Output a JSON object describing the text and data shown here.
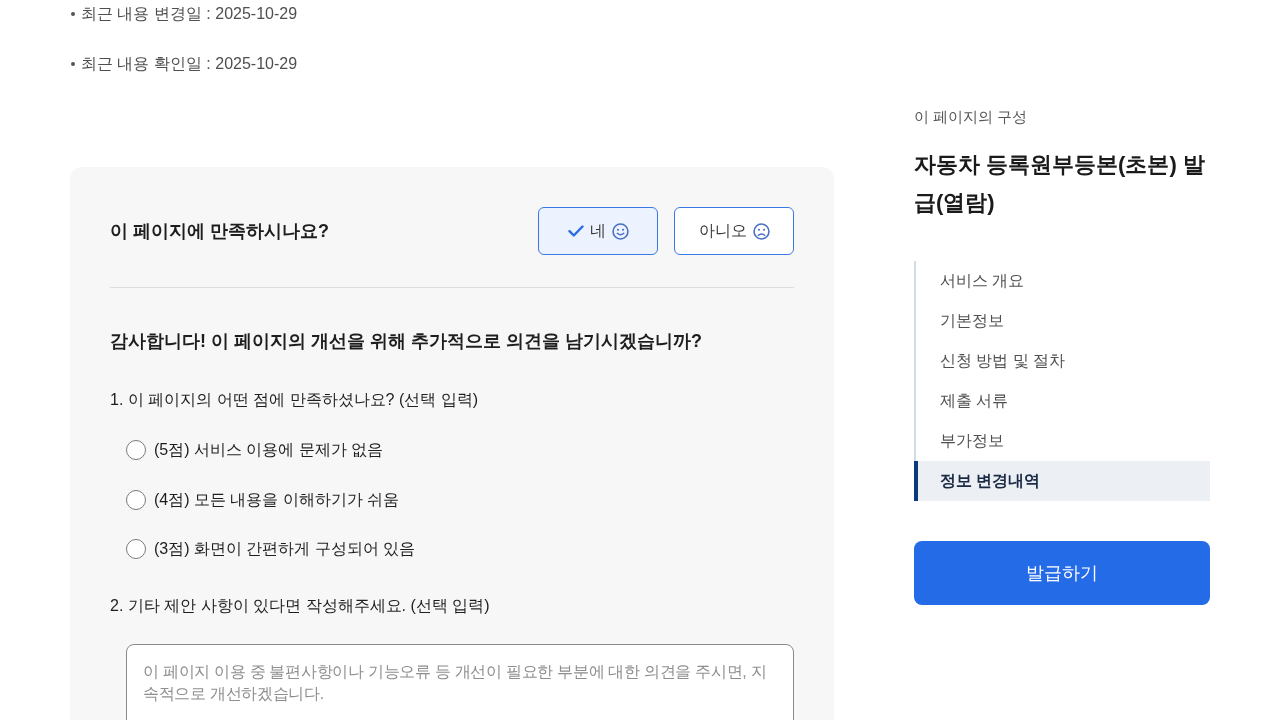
{
  "page_info": {
    "items": [
      "최근 내용 변경일 : 2025-10-29",
      "최근 내용 확인일 : 2025-10-29"
    ]
  },
  "feedback": {
    "question": "이 페이지에 만족하시나요?",
    "answers": [
      {
        "kind": "yes",
        "label": "네",
        "selected": true
      },
      {
        "kind": "no",
        "label": "아니오",
        "selected": false
      }
    ],
    "follow_up": "감사합니다! 이 페이지의 개선을 위해 추가적으로 의견을 남기시겠습니까?",
    "questions": [
      {
        "kind": "choice",
        "label": "1. 이 페이지의 어떤 점에 만족하셨나요? (선택 입력)",
        "options": [
          {
            "label": "(5점) 서비스 이용에 문제가 없음",
            "selected": false
          },
          {
            "label": "(4점) 모든 내용을 이해하기가 쉬움",
            "selected": false
          },
          {
            "label": "(3점) 화면이 간편하게 구성되어 있음",
            "selected": false
          }
        ]
      },
      {
        "kind": "text",
        "label": "2. 기타 제안 사항이 있다면 작성해주세요. (선택 입력)",
        "placeholder": "이 페이지 이용 중 불편사항이나 기능오류 등 개선이 필요한 부분에 대한 의견을 주시면, 지속적으로 개선하겠습니다."
      }
    ]
  },
  "sidebar": {
    "caption": "이 페이지의 구성",
    "title": "자동차 등록원부등본(초본) 발급(열람)",
    "nav": [
      {
        "label": "서비스 개요",
        "selected": false
      },
      {
        "label": "기본정보",
        "selected": false
      },
      {
        "label": "신청 방법 및 절차",
        "selected": false
      },
      {
        "label": "제출 서류",
        "selected": false
      },
      {
        "label": "부가정보",
        "selected": false
      },
      {
        "label": "정보 변경내역",
        "selected": true
      }
    ],
    "action_button": "발급하기"
  }
}
